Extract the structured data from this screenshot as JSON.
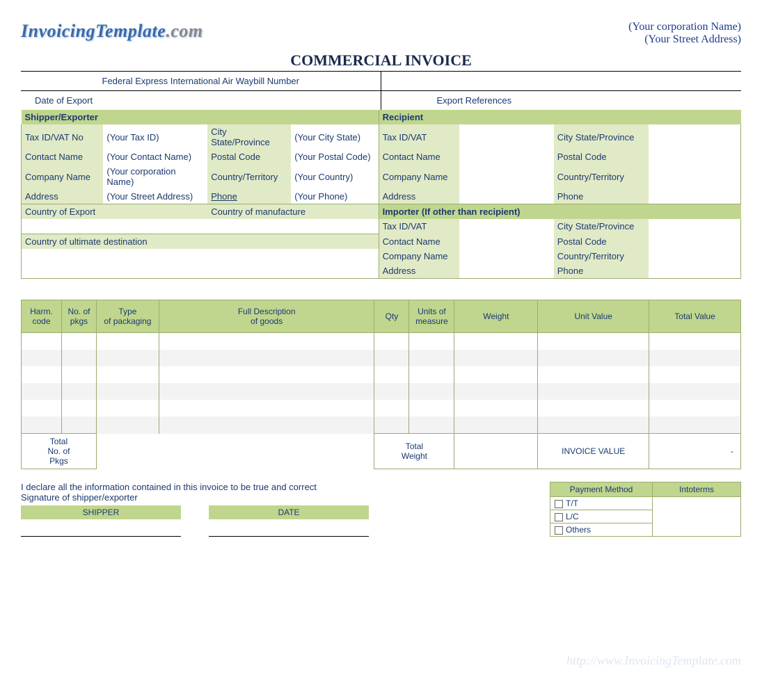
{
  "logo": {
    "text": "InvoicingTemplate",
    "suffix": ".com"
  },
  "corp": {
    "name": "(Your corporation  Name)",
    "address": "(Your Street Address)"
  },
  "title": "COMMERCIAL INVOICE",
  "top": {
    "waybill": "Federal Express International Air Waybill Number",
    "date_export": "Date of Export",
    "export_ref": "Export References"
  },
  "shipper": {
    "heading": "Shipper/Exporter",
    "tax_l": "Tax ID/VAT No",
    "tax_v": "(Your Tax ID)",
    "contact_l": "Contact Name",
    "contact_v": "(Your Contact Name)",
    "company_l": "Company Name",
    "company_v": "(Your corporation  Name)",
    "address_l": "Address",
    "address_v": "(Your Street Address)",
    "city_l": "City  State/Province",
    "city_v": "(Your City State)",
    "postal_l": "Postal Code",
    "postal_v": "(Your Postal Code)",
    "country_l": "Country/Territory",
    "country_v": "(Your Country)",
    "phone_l": "Phone",
    "phone_v": "(Your Phone)"
  },
  "recipient": {
    "heading": "Recipient",
    "tax_l": "Tax ID/VAT",
    "contact_l": "Contact Name",
    "company_l": "Company Name",
    "address_l": "Address",
    "city_l": "City  State/Province",
    "postal_l": "Postal Code",
    "country_l": "Country/Territory",
    "phone_l": "Phone"
  },
  "countries": {
    "export": "Country of Export",
    "manufacture": "Country of manufacture",
    "destination": "Country of ultimate destination"
  },
  "importer": {
    "heading": "Importer (If other than recipient)",
    "tax_l": "Tax ID/VAT",
    "contact_l": "Contact Name",
    "company_l": "Company Name",
    "address_l": "Address",
    "city_l": "City  State/Province",
    "postal_l": "Postal Code",
    "country_l": "Country/Territory",
    "phone_l": "Phone"
  },
  "goods": {
    "h_harm": "Harm.\ncode",
    "h_pkgs": "No. of\npkgs",
    "h_type": "Type\nof packaging",
    "h_desc": "Full Description\nof goods",
    "h_qty": "Qty",
    "h_units": "Units of\nmeasure",
    "h_weight": "Weight",
    "h_unitval": "Unit Value",
    "h_totalval": "Total Value",
    "foot_pkgs": "Total\nNo. of\nPkgs",
    "foot_weight": "Total\nWeight",
    "foot_inv": "INVOICE VALUE",
    "foot_dash": "-"
  },
  "decl": {
    "line1": "I declare all the information contained in this invoice to be true and correct",
    "line2": "Signature of shipper/exporter",
    "shipper": "SHIPPER",
    "date": "DATE"
  },
  "pm": {
    "h_method": "Payment Method",
    "h_into": "Intoterms",
    "tt": "T/T",
    "lc": "L/C",
    "others": "Others"
  },
  "watermark": "http://www.InvoicingTemplate.com"
}
